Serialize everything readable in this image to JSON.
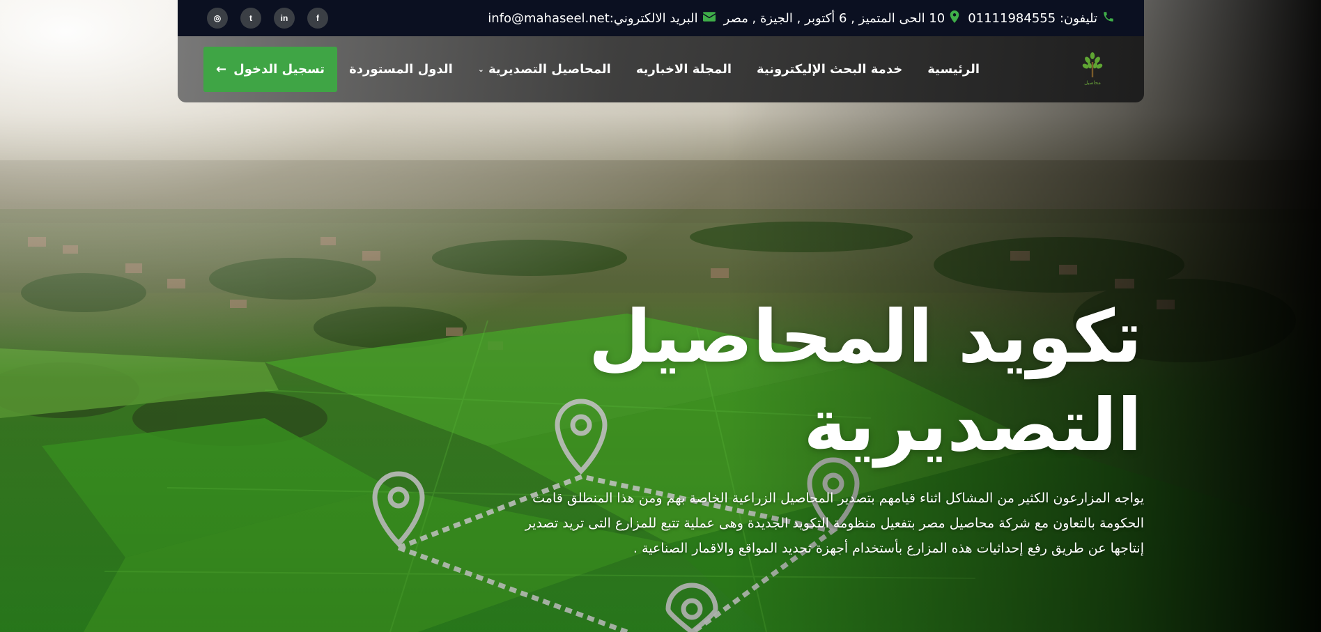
{
  "topbar": {
    "phone_label": "تليفون: 01111984555",
    "address": "10 الحى المتميز , 6 أكتوبر , الجيزة , مصر",
    "email_label": "البريد الالكتروني:info@mahaseel.net",
    "phone_icon": "phone-icon",
    "address_icon": "map-marker-icon",
    "email_icon": "envelope-icon",
    "socials": [
      {
        "name": "facebook-icon",
        "glyph": "f"
      },
      {
        "name": "linkedin-icon",
        "glyph": "in"
      },
      {
        "name": "twitter-icon",
        "glyph": "t"
      },
      {
        "name": "instagram-icon",
        "glyph": "◎"
      }
    ]
  },
  "nav": {
    "logo_caption": "محاصيل",
    "items": [
      {
        "label": "الرئيسية"
      },
      {
        "label": "خدمة البحث الإليكترونية"
      },
      {
        "label": "المجلة الاخباريه"
      },
      {
        "label": "المحاصيل التصديرية",
        "chevron": "⌄"
      },
      {
        "label": "الدول المستوردة"
      }
    ],
    "login_label": "تسجيل الدخول",
    "login_arrow": "←"
  },
  "hero": {
    "title_line1": "تكويد المحاصيل",
    "title_line2": "التصديرية",
    "description": "يواجه المزارعون الكثير من المشاكل اثناء قيامهم بتصدير المحاصيل الزراعية الخاصة بهم ومن هذا المنطلق قامت الحكومة بالتعاون مع شركة محاصيل مصر بتفعيل منظومة التكويد الجديدة وهى عملية تتبع للمزارع التى تريد تصدير إنتاجها عن طريق رفع إحداثيات هذه المزارع بأستخدام أجهزة تحديد المواقع والاقمار الصناعية ."
  },
  "colors": {
    "accent_green": "#3fa545",
    "topbar_bg": "#0b1021",
    "icon_green": "#3fae49"
  }
}
